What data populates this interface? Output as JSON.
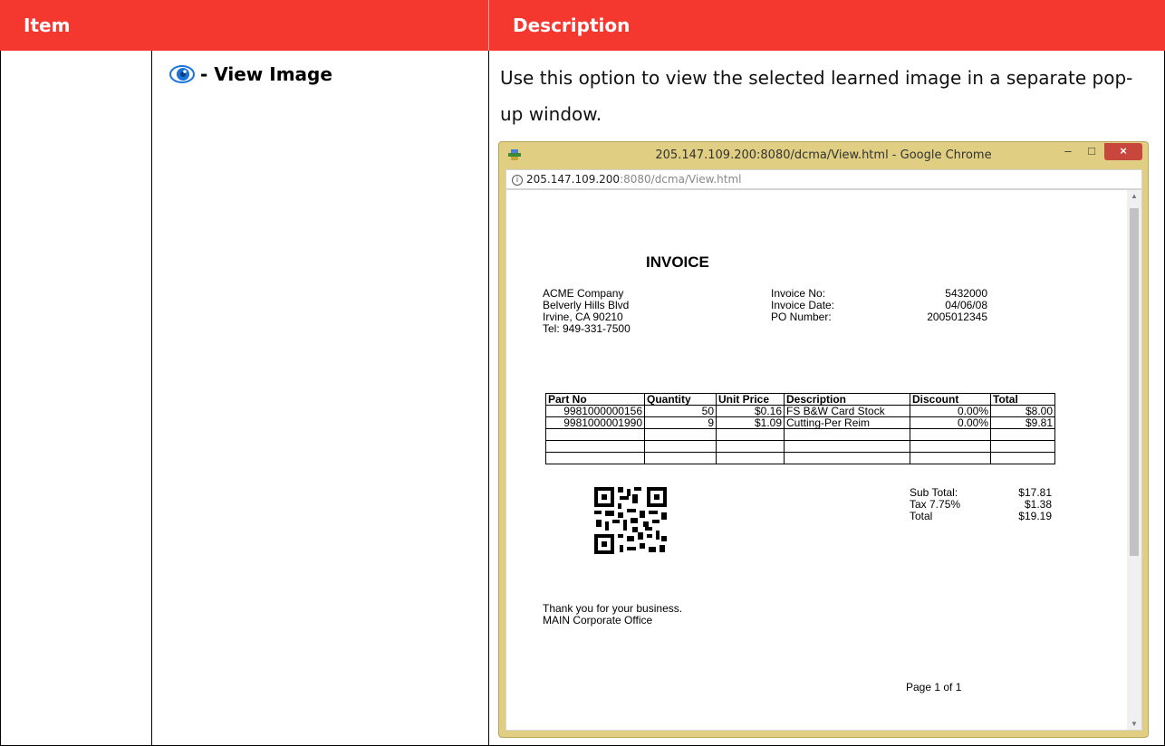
{
  "table": {
    "header_item": "Item",
    "header_description": "Description"
  },
  "row": {
    "item_icon": "eye-icon",
    "item_label": "- View Image",
    "description": "Use this option to view the selected learned image in a separate pop-up window."
  },
  "browser": {
    "title": "205.147.109.200:8080/dcma/View.html - Google Chrome",
    "url_host": "205.147.109.200",
    "url_path": ":8080/dcma/View.html",
    "minimize": "–",
    "maximize": "□",
    "close": "×"
  },
  "invoice": {
    "title": "INVOICE",
    "company": [
      "ACME Company",
      "Belverly Hills Blvd",
      "Irvine, CA 90210",
      "Tel: 949-331-7500"
    ],
    "meta_labels": [
      "Invoice No:",
      "Invoice Date:",
      "PO Number:"
    ],
    "meta_values": [
      "5432000",
      "04/06/08",
      "2005012345"
    ],
    "columns": [
      "Part No",
      "Quantity",
      "Unit Price",
      "Description",
      "Discount",
      "Total"
    ],
    "rows": [
      [
        "9981000000156",
        "50",
        "$0.16",
        "FS B&W Card Stock",
        "0.00%",
        "$8.00"
      ],
      [
        "9981000001990",
        "9",
        "$1.09",
        "Cutting-Per Reim",
        "0.00%",
        "$9.81"
      ]
    ],
    "totals_labels": [
      "Sub Total:",
      "Tax 7.75%",
      "Total"
    ],
    "totals_values": [
      "$17.81",
      "$1.38",
      "$19.19"
    ],
    "thanks": [
      "Thank you for your business.",
      "MAIN Corporate Office"
    ],
    "page": "Page 1 of 1"
  },
  "colors": {
    "header_bg": "#f4372f",
    "window_frame": "#e0cf83",
    "close_button": "#c9463d",
    "eye_icon": "#1a73d9"
  }
}
